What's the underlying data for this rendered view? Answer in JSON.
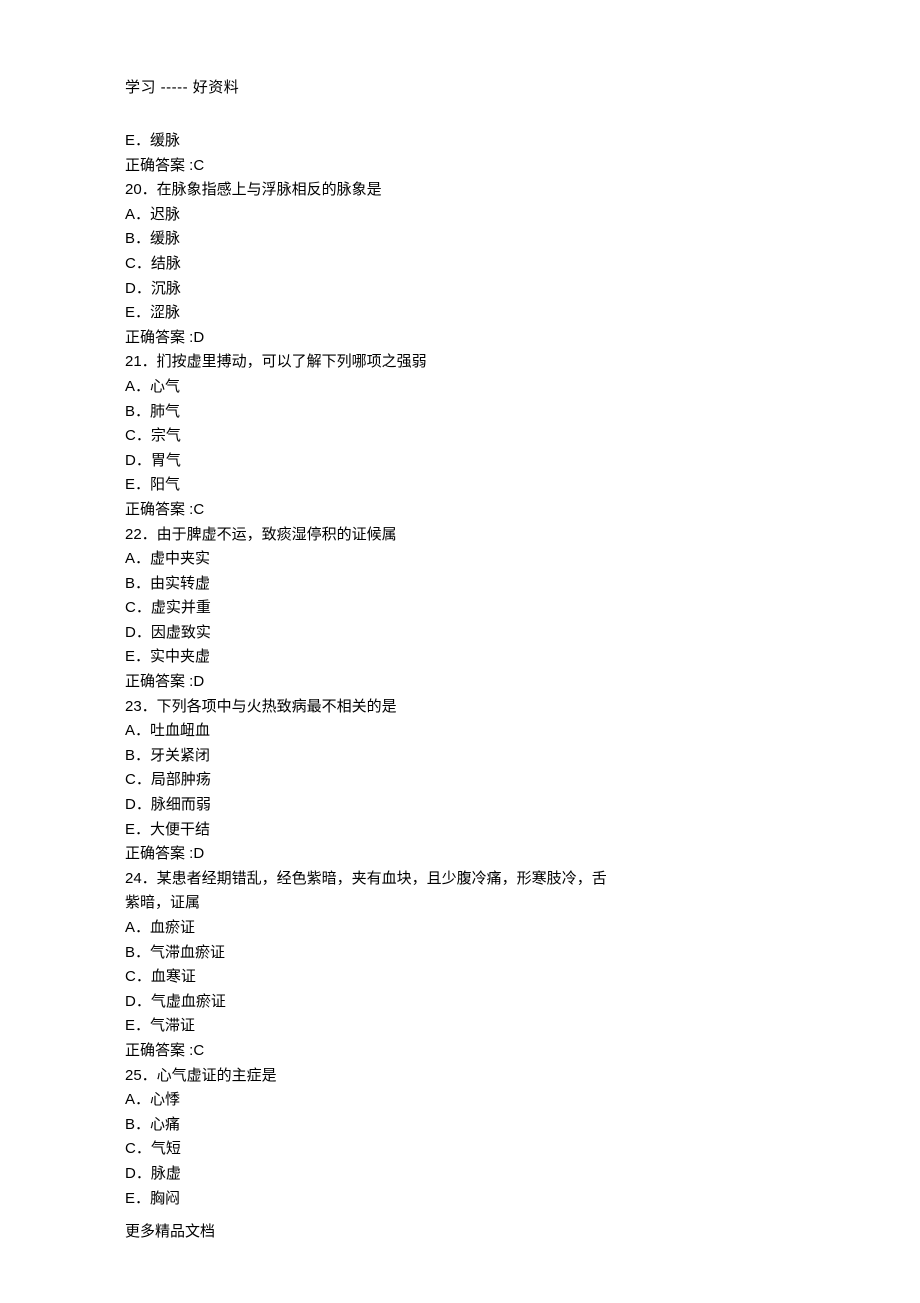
{
  "header": "学习 ----- 好资料",
  "footer": "更多精品文档",
  "lines": [
    "E．缓脉",
    "正确答案 :C",
    "20．在脉象指感上与浮脉相反的脉象是",
    "A．迟脉",
    "B．缓脉",
    "C．结脉",
    "D．沉脉",
    "E．涩脉",
    "正确答案 :D",
    "21．扪按虚里搏动，可以了解下列哪项之强弱",
    "A．心气",
    "B．肺气",
    "C．宗气",
    "D．胃气",
    "E．阳气",
    "正确答案 :C",
    "22．由于脾虚不运，致痰湿停积的证候属",
    "A．虚中夹实",
    "B．由实转虚",
    "C．虚实并重",
    "D．因虚致实",
    "E．实中夹虚",
    "正确答案 :D",
    "23．下列各项中与火热致病最不相关的是",
    "A．吐血衄血",
    "B．牙关紧闭",
    "C．局部肿疡",
    "D．脉细而弱",
    "E．大便干结",
    "正确答案 :D",
    "24．某患者经期错乱，经色紫暗，夹有血块，且少腹冷痛，形寒肢冷，舌",
    "紫暗，证属",
    "A．血瘀证",
    "B．气滞血瘀证",
    "C．血寒证",
    "D．气虚血瘀证",
    "E．气滞证",
    "正确答案 :C",
    "25．心气虚证的主症是",
    "A．心悸",
    "B．心痛",
    "C．气短",
    "D．脉虚",
    "E．胸闷"
  ]
}
